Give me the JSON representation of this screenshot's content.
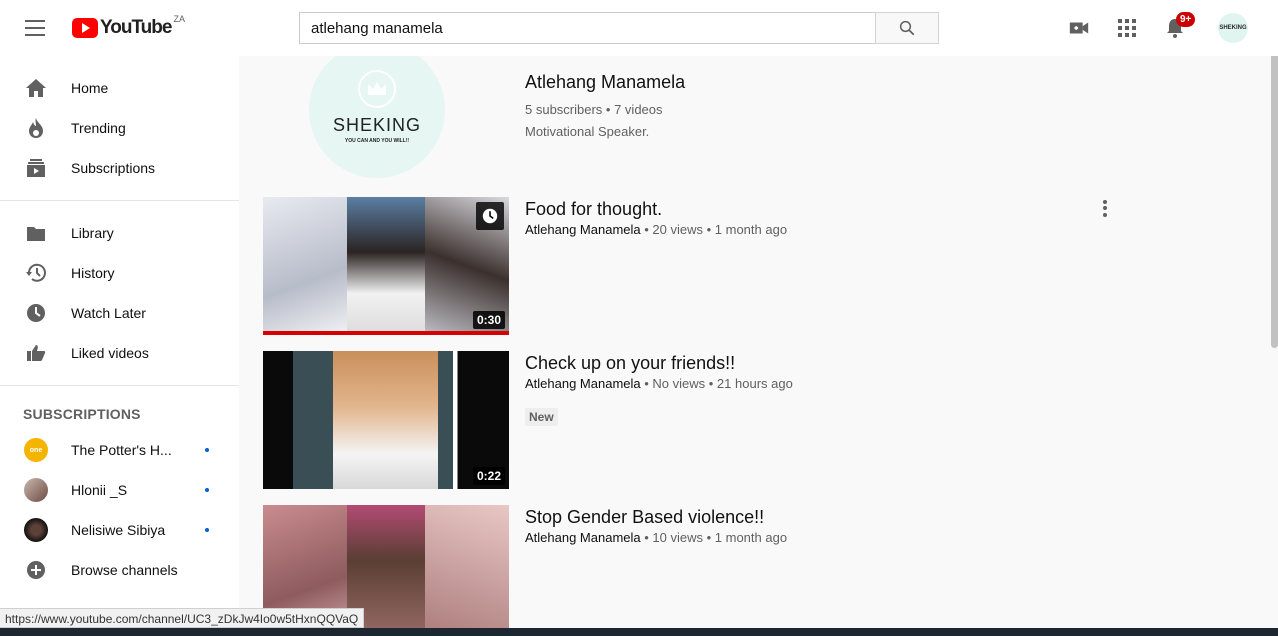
{
  "header": {
    "logo_text": "YouTube",
    "region": "ZA",
    "search_value": "atlehang manamela",
    "notification_count": "9+",
    "avatar_text": "SHEKING"
  },
  "sidebar": {
    "main": [
      {
        "label": "Home",
        "icon": "home-icon"
      },
      {
        "label": "Trending",
        "icon": "trending-icon"
      },
      {
        "label": "Subscriptions",
        "icon": "subscriptions-icon"
      }
    ],
    "library": [
      {
        "label": "Library",
        "icon": "library-icon"
      },
      {
        "label": "History",
        "icon": "history-icon"
      },
      {
        "label": "Watch Later",
        "icon": "watch-later-icon"
      },
      {
        "label": "Liked videos",
        "icon": "liked-icon"
      }
    ],
    "subscriptions_heading": "SUBSCRIPTIONS",
    "subscriptions": [
      {
        "label": "The Potter's H...",
        "color": "#f5b400"
      },
      {
        "label": "Hlonii _S",
        "color": "#8a6a5a"
      },
      {
        "label": "Nelisiwe Sibiya",
        "color": "#2a2a2a"
      }
    ],
    "browse_label": "Browse channels"
  },
  "channel": {
    "avatar_title": "SHEKING",
    "avatar_subtitle": "YOU CAN AND YOU WILL!!",
    "name": "Atlehang Manamela",
    "stats": "5 subscribers • 7 videos",
    "description": "Motivational Speaker."
  },
  "videos": [
    {
      "title": "Food for thought.",
      "channel": "Atlehang Manamela",
      "meta": " • 20 views • 1 month ago",
      "duration": "0:30",
      "badge": ""
    },
    {
      "title": "Check up on your friends!!",
      "channel": "Atlehang Manamela",
      "meta": " • No views • 21 hours ago",
      "duration": "0:22",
      "badge": "New"
    },
    {
      "title": "Stop Gender Based violence!!",
      "channel": "Atlehang Manamela",
      "meta": " • 10 views • 1 month ago",
      "duration": "",
      "badge": ""
    }
  ],
  "status_url": "https://www.youtube.com/channel/UC3_zDkJw4Io0w5tHxnQQVaQ"
}
